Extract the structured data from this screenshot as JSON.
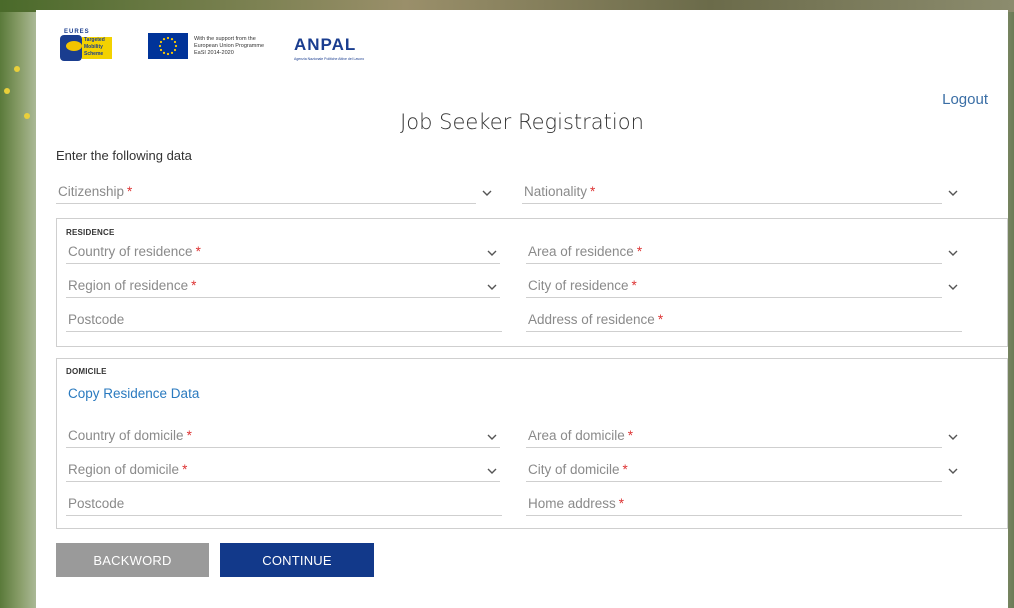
{
  "header": {
    "logout_label": "Logout",
    "logo_tms_top": "EURES",
    "logo_tms_text": "Targeted Mobility Scheme",
    "eu_support_text": "With the support from the European Union Programme EaSI 2014-2020",
    "anpal_logo": "ANPAL",
    "anpal_sub": "Agenzia Nazionale Politiche Attive del Lavoro"
  },
  "page": {
    "title": "Job Seeker Registration",
    "intro": "Enter the following data"
  },
  "top_fields": {
    "citizenship": "Citizenship",
    "nationality": "Nationality"
  },
  "residence": {
    "section_title": "RESIDENCE",
    "country": "Country of residence",
    "area": "Area of residence",
    "region": "Region of residence",
    "city": "City of residence",
    "postcode": "Postcode",
    "address": "Address of residence"
  },
  "domicile": {
    "section_title": "DOMICILE",
    "copy_link": "Copy Residence Data",
    "country": "Country of domicile",
    "area": "Area of domicile",
    "region": "Region of domicile",
    "city": "City of domicile",
    "postcode": "Postcode",
    "address": "Home address"
  },
  "required_marker": "*",
  "buttons": {
    "back": "BACKWORD",
    "continue": "CONTINUE"
  },
  "colors": {
    "primary": "#12398a",
    "link": "#2a7abf",
    "required": "#dd3333",
    "secondary_button": "#9a9a9a"
  }
}
